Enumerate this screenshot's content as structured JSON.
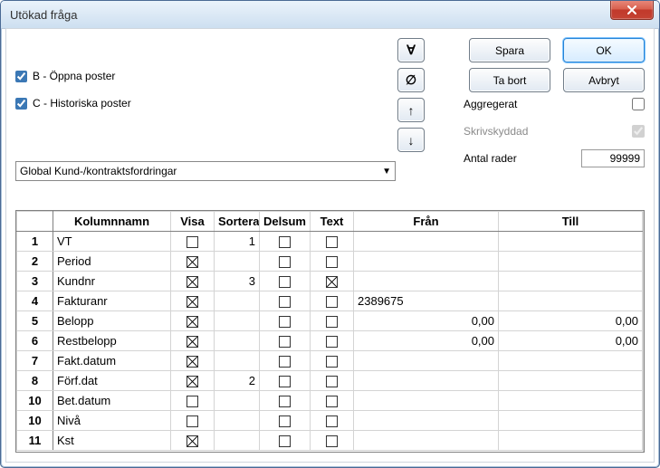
{
  "window": {
    "title": "Utökad fråga"
  },
  "checks": {
    "b": {
      "label": "B - Öppna poster",
      "checked": true
    },
    "c": {
      "label": "C - Historiska poster",
      "checked": true
    }
  },
  "arrow_buttons": {
    "all": "∀",
    "none": "∅",
    "up": "↑",
    "down": "↓"
  },
  "buttons": {
    "save": "Spara",
    "ok": "OK",
    "delete": "Ta bort",
    "cancel": "Avbryt"
  },
  "options": {
    "aggregate": {
      "label": "Aggregerat",
      "checked": false
    },
    "readonly": {
      "label": "Skrivskyddad",
      "checked": true,
      "disabled": true
    },
    "rows": {
      "label": "Antal rader",
      "value": "99999"
    }
  },
  "combo": {
    "value": "Global Kund-/kontraktsfordringar"
  },
  "grid": {
    "headers": {
      "rownum": "",
      "name": "Kolumnnamn",
      "visa": "Visa",
      "sortera": "Sortera",
      "delsum": "Delsum",
      "text": "Text",
      "from": "Från",
      "to": "Till"
    },
    "rows": [
      {
        "n": "1",
        "name": "VT",
        "visa": false,
        "sort": "1",
        "del": false,
        "text": false,
        "from": "",
        "to": ""
      },
      {
        "n": "2",
        "name": "Period",
        "visa": true,
        "sort": "",
        "del": false,
        "text": false,
        "from": "",
        "to": ""
      },
      {
        "n": "3",
        "name": "Kundnr",
        "visa": true,
        "sort": "3",
        "del": false,
        "text": true,
        "from": "",
        "to": ""
      },
      {
        "n": "4",
        "name": "Fakturanr",
        "visa": true,
        "sort": "",
        "del": false,
        "text": false,
        "from": "2389675",
        "to": ""
      },
      {
        "n": "5",
        "name": "Belopp",
        "visa": true,
        "sort": "",
        "del": false,
        "text": false,
        "from": "0,00",
        "from_align": "right",
        "to": "0,00",
        "to_align": "right"
      },
      {
        "n": "6",
        "name": "Restbelopp",
        "visa": true,
        "sort": "",
        "del": false,
        "text": false,
        "from": "0,00",
        "from_align": "right",
        "to": "0,00",
        "to_align": "right"
      },
      {
        "n": "7",
        "name": "Fakt.datum",
        "visa": true,
        "sort": "",
        "del": false,
        "text": false,
        "from": "",
        "to": ""
      },
      {
        "n": "8",
        "name": "Förf.dat",
        "visa": true,
        "sort": "2",
        "del": false,
        "text": false,
        "from": "",
        "to": ""
      },
      {
        "n": "10",
        "name": "Bet.datum",
        "visa": false,
        "sort": "",
        "del": false,
        "text": false,
        "from": "",
        "to": ""
      },
      {
        "n": "10",
        "name": "Nivå",
        "visa": false,
        "sort": "",
        "del": false,
        "text": false,
        "from": "",
        "to": ""
      },
      {
        "n": "11",
        "name": "Kst",
        "visa": true,
        "sort": "",
        "del": false,
        "text": false,
        "from": "",
        "to": ""
      }
    ]
  }
}
